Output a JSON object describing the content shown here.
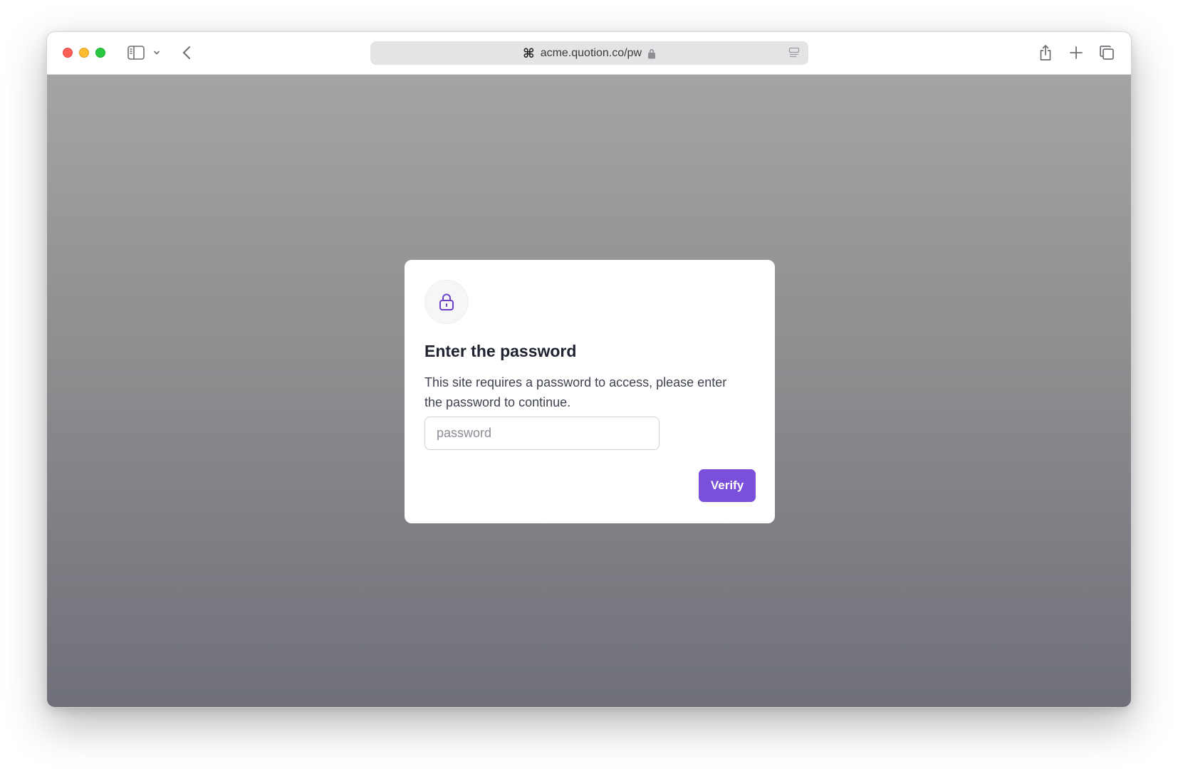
{
  "browser": {
    "url": "acme.quotion.co/pw",
    "url_prefix_icon": "command-icon",
    "secure_icon": "lock-icon",
    "reader_icon": "reader-icon"
  },
  "dialog": {
    "icon": "lock-icon",
    "title": "Enter the password",
    "description": "This site requires a password to access, please enter the password to continue.",
    "password_placeholder": "password",
    "password_value": "",
    "verify_label": "Verify"
  },
  "colors": {
    "accent": "#7a4fd9",
    "icon_accent": "#6e3fc4",
    "background_top": "#a4a4a4",
    "background_bottom": "#6f7079"
  }
}
